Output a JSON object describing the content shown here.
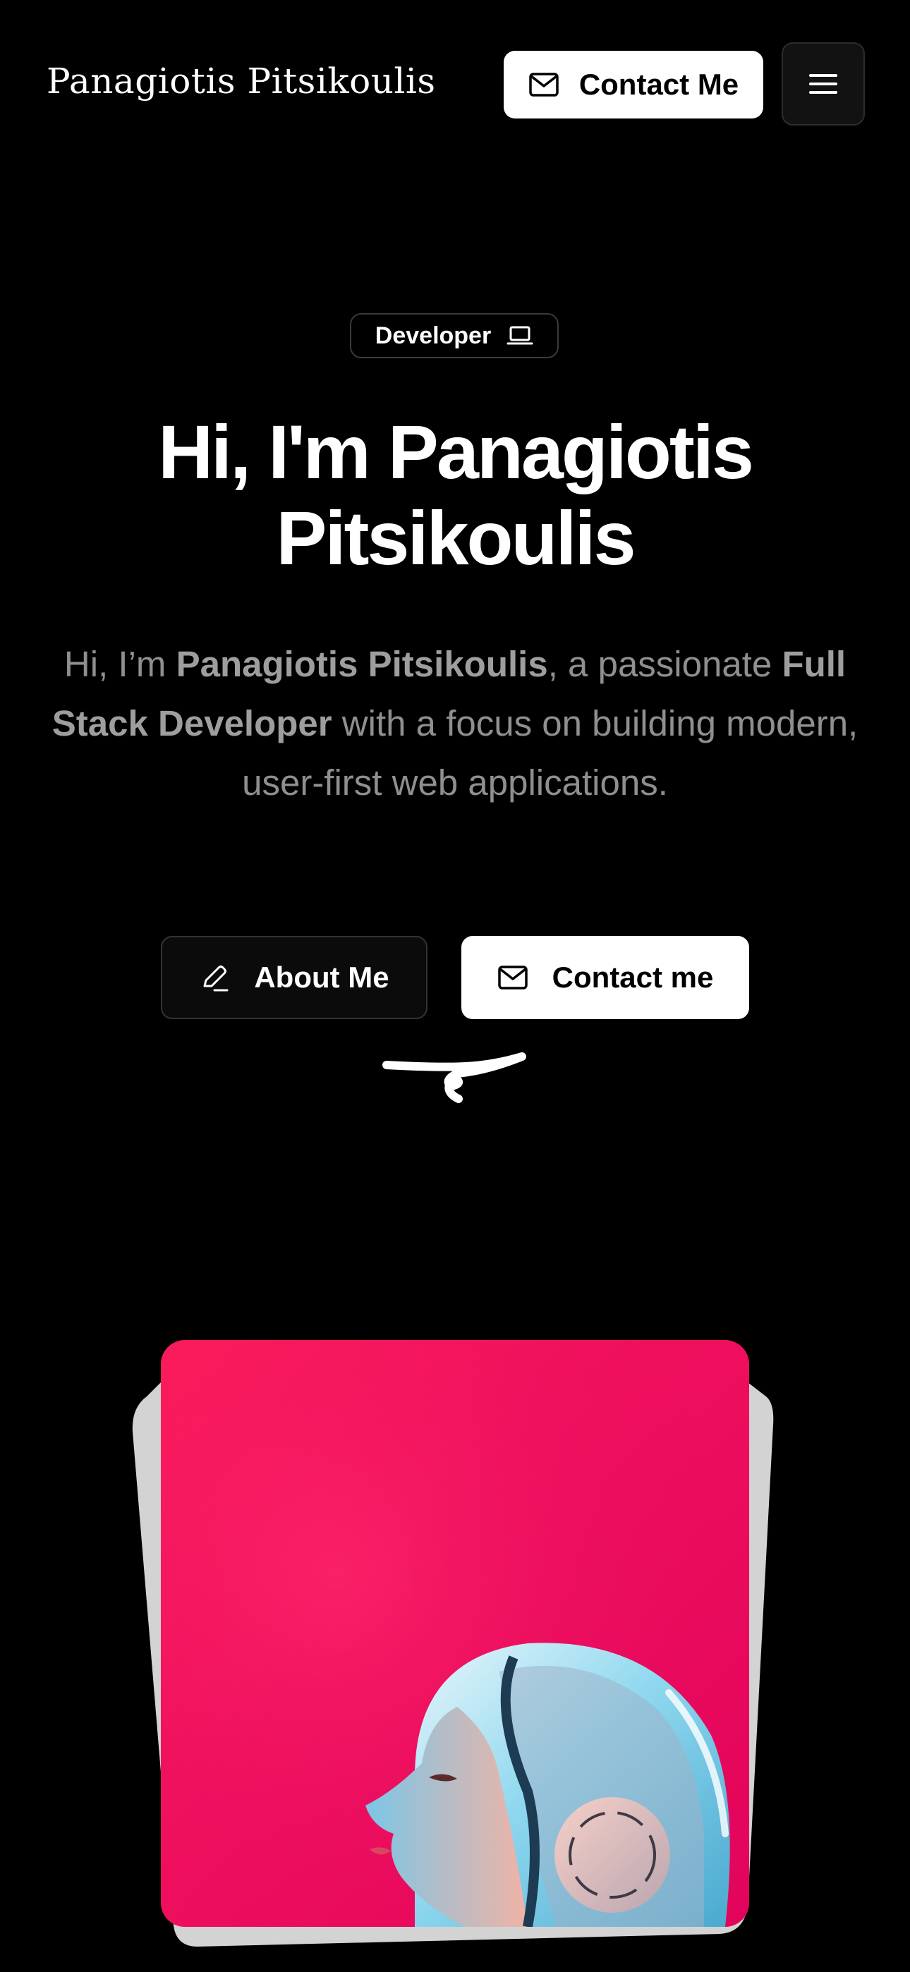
{
  "header": {
    "brand": "Panagiotis Pitsikoulis",
    "contact_label": "Contact Me"
  },
  "hero": {
    "badge": "Developer",
    "title_line1": "Hi, I'm Panagiotis",
    "title_line2": "Pitsikoulis",
    "desc": {
      "t1": "Hi, I’m ",
      "b1": "Panagiotis Pitsikoulis",
      "t2": ", a passionate ",
      "b2": "Full Stack Developer",
      "t3": " with a focus on building modern, user-first web applications."
    },
    "about_label": "About Me",
    "contact_label": "Contact me"
  },
  "icons": {
    "mail": "mail-icon",
    "menu": "menu-icon",
    "laptop": "laptop-icon",
    "pencil": "pencil-icon"
  },
  "colors": {
    "background": "#000000",
    "card_pink": "#f0105d",
    "muted_text": "#8f8f8f"
  }
}
